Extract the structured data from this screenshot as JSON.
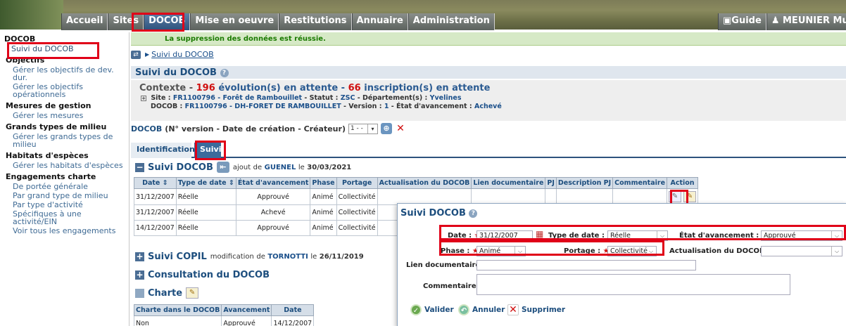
{
  "nav": {
    "items": [
      "Accueil",
      "Sites",
      "DOCOB",
      "Mise en oeuvre",
      "Restitutions",
      "Annuaire",
      "Administration"
    ],
    "guide": "Guide",
    "user": "MEUNIER Muri"
  },
  "sidebar": {
    "title": "DOCOB",
    "selected": "Suivi du DOCOB",
    "groups": [
      {
        "head": "Objectifs",
        "links": [
          "Gérer les objectifs de dev. dur.",
          "Gérer les objectifs opérationnels"
        ]
      },
      {
        "head": "Mesures de gestion",
        "links": [
          "Gérer les mesures"
        ]
      },
      {
        "head": "Grands types de milieu",
        "links": [
          "Gérer les grands types de milieu"
        ]
      },
      {
        "head": "Habitats d'espèces",
        "links": [
          "Gérer les habitats d'espèces"
        ]
      },
      {
        "head": "Engagements charte",
        "links": [
          "De portée générale",
          "Par grand type de milieu",
          "Par type d'activité",
          "Spécifiques à une activité/EIN",
          "Voir tous les engagements"
        ]
      }
    ]
  },
  "message": "La suppression des données est réussie.",
  "breadcrumb": "Suivi du DOCOB",
  "page_title": "Suivi du DOCOB",
  "context": {
    "label": "Contexte -",
    "count1": "196",
    "text1": "évolution(s) en attente -",
    "count2": "66",
    "text2": "inscription(s) en attente",
    "site_label": "Site :",
    "site_value": "FR1100796 - Forêt de Rambouillet",
    "statut_label": "- Statut :",
    "statut_value": "ZSC",
    "dept_label": "- Département(s) :",
    "dept_value": "Yvelines",
    "docob_label": "DOCOB :",
    "docob_value": "FR1100796 - DH-FORET DE RAMBOUILLET",
    "version_label": "- Version :",
    "version_value": "1",
    "etat_label": "- État d'avancement :",
    "etat_value": "Achevé"
  },
  "docob_select": {
    "label": "DOCOB",
    "hint": "(N° version - Date de création - Créateur)",
    "value": "1 - -"
  },
  "tabs": [
    "Identification",
    "Suivi"
  ],
  "suivi": {
    "title": "Suivi DOCOB",
    "note_pre": "ajout",
    "note_de": "de",
    "note_user": "GUENEL",
    "note_le": "le",
    "note_date": "30/03/2021",
    "headers": [
      "Date ⇕",
      "Type de date ⇕",
      "État d'avancement",
      "Phase",
      "Portage",
      "Actualisation du DOCOB",
      "Lien documentaire",
      "PJ",
      "Description PJ",
      "Commentaire",
      "Action"
    ],
    "rows": [
      [
        "31/12/2007",
        "Réelle",
        "Approuvé",
        "Animé",
        "Collectivité"
      ],
      [
        "31/12/2007",
        "Réelle",
        "Achevé",
        "Animé",
        "Collectivité"
      ],
      [
        "14/12/2007",
        "Réelle",
        "Approuvé",
        "Animé",
        "Collectivité"
      ]
    ]
  },
  "copil": {
    "title": "Suivi COPIL",
    "note_pre": "modification",
    "note_de": "de",
    "note_user": "TORNOTTI",
    "note_le": "le",
    "note_date": "26/11/2019"
  },
  "consultation": {
    "title": "Consultation du DOCOB"
  },
  "charte": {
    "title": "Charte",
    "headers": [
      "Charte dans le DOCOB",
      "Avancement",
      "Date"
    ],
    "row": [
      "Non",
      "Approuvé",
      "14/12/2007"
    ]
  },
  "popup": {
    "title": "Suivi DOCOB",
    "date_label": "Date :",
    "date_value": "31/12/2007",
    "type_label": "Type de date :",
    "type_value": "Réelle",
    "etat_label": "État d'avancement :",
    "etat_value": "Approuvé",
    "phase_label": "Phase :",
    "phase_value": "Animé",
    "portage_label": "Portage :",
    "portage_value": "Collectivité",
    "actu_label": "Actualisation du DOCOB :",
    "actu_value": "",
    "lien_label": "Lien documentaire :",
    "lien_value": "",
    "comment_label": "Commentaire :",
    "comment_value": "",
    "btn_valider": "Valider",
    "btn_annuler": "Annuler",
    "btn_supprimer": "Supprimer"
  }
}
